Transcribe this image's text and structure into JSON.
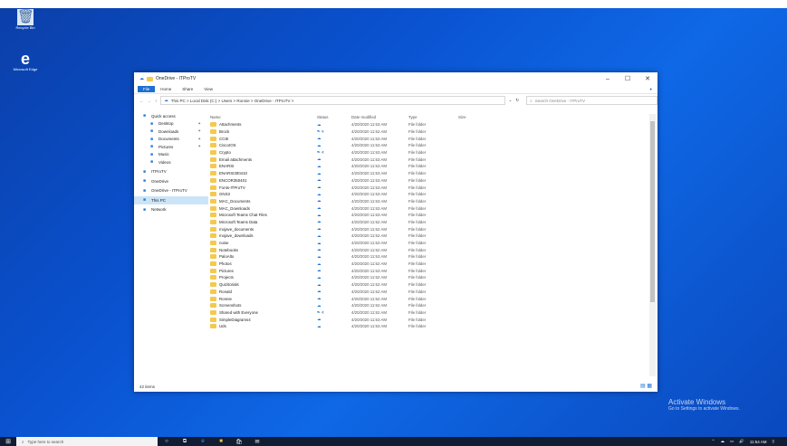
{
  "desktop": {
    "icons": [
      {
        "name": "recycle-bin-icon",
        "label": "Recycle Bin"
      },
      {
        "name": "edge-icon",
        "label": "Microsoft Edge"
      }
    ]
  },
  "window": {
    "title": "OneDrive - ITProTV",
    "ribbon_tabs": [
      "File",
      "Home",
      "Share",
      "View"
    ],
    "breadcrumb": "This PC  >  Local Disk (C:)  >  Users  >  Ronnie  >  OneDrive - ITProTV  >",
    "search_placeholder": "Search OneDrive - ITProTV",
    "nav": [
      {
        "label": "Quick access",
        "level": 0,
        "icon": "star-icon",
        "pin": false
      },
      {
        "label": "Desktop",
        "level": 1,
        "icon": "desktop-icon",
        "pin": true
      },
      {
        "label": "Downloads",
        "level": 1,
        "icon": "download-icon",
        "pin": true
      },
      {
        "label": "Documents",
        "level": 1,
        "icon": "documents-icon",
        "pin": true
      },
      {
        "label": "Pictures",
        "level": 1,
        "icon": "pictures-icon",
        "pin": true
      },
      {
        "label": "Music",
        "level": 1,
        "icon": "music-icon",
        "pin": false
      },
      {
        "label": "Videos",
        "level": 1,
        "icon": "videos-icon",
        "pin": false
      },
      {
        "label": "ITProTV",
        "level": 0,
        "icon": "user-icon",
        "pin": false
      },
      {
        "label": "OneDrive",
        "level": 0,
        "icon": "cloud-icon",
        "pin": false
      },
      {
        "label": "OneDrive - ITProTV",
        "level": 0,
        "icon": "cloud-icon",
        "pin": false
      },
      {
        "label": "This PC",
        "level": 0,
        "icon": "computer-icon",
        "pin": false,
        "selected": true
      },
      {
        "label": "Network",
        "level": 0,
        "icon": "network-icon",
        "pin": false
      }
    ],
    "columns": {
      "name": "Name",
      "status": "Status",
      "date": "Date modified",
      "type": "Type",
      "size": "Size"
    },
    "files": [
      {
        "name": "Attachments",
        "status": "☁",
        "date": "4/20/2020 11:53 AM",
        "type": "File folder"
      },
      {
        "name": "Brock",
        "status": "☁ ዳ",
        "date": "4/20/2020 11:52 AM",
        "type": "File folder"
      },
      {
        "name": "CCIE",
        "status": "☁",
        "date": "4/20/2020 11:53 AM",
        "type": "File folder"
      },
      {
        "name": "CiscoIOS",
        "status": "☁",
        "date": "4/20/2020 11:53 AM",
        "type": "File folder"
      },
      {
        "name": "Crypto",
        "status": "☁ ዳ",
        "date": "4/20/2020 11:53 AM",
        "type": "File folder"
      },
      {
        "name": "Email attachments",
        "status": "☁",
        "date": "4/20/2020 11:53 AM",
        "type": "File folder"
      },
      {
        "name": "ENARSI",
        "status": "☁",
        "date": "4/20/2020 11:53 AM",
        "type": "File folder"
      },
      {
        "name": "ENARSI300410",
        "status": "☁",
        "date": "4/20/2020 11:53 AM",
        "type": "File folder"
      },
      {
        "name": "ENCOR350401",
        "status": "☁",
        "date": "4/20/2020 11:53 AM",
        "type": "File folder"
      },
      {
        "name": "Fonts-ITProTV",
        "status": "☁",
        "date": "4/20/2020 11:53 AM",
        "type": "File folder"
      },
      {
        "name": "GNS3",
        "status": "☁",
        "date": "4/20/2020 11:53 AM",
        "type": "File folder"
      },
      {
        "name": "MAC_Documents",
        "status": "☁",
        "date": "4/20/2020 11:53 AM",
        "type": "File folder"
      },
      {
        "name": "MAC_Downloads",
        "status": "☁",
        "date": "4/20/2020 11:53 AM",
        "type": "File folder"
      },
      {
        "name": "Microsoft Teams Chat Files",
        "status": "☁",
        "date": "4/20/2020 11:53 AM",
        "type": "File folder"
      },
      {
        "name": "Microsoft Teams Data",
        "status": "☁",
        "date": "4/20/2020 11:52 AM",
        "type": "File folder"
      },
      {
        "name": "mojave_documents",
        "status": "☁",
        "date": "4/20/2020 11:52 AM",
        "type": "File folder"
      },
      {
        "name": "mojave_downloads",
        "status": "☁",
        "date": "4/20/2020 11:52 AM",
        "type": "File folder"
      },
      {
        "name": "noise",
        "status": "☁",
        "date": "4/20/2020 11:53 AM",
        "type": "File folder"
      },
      {
        "name": "Notebooks",
        "status": "☁",
        "date": "4/20/2020 11:52 AM",
        "type": "File folder"
      },
      {
        "name": "PaloAlto",
        "status": "☁",
        "date": "4/20/2020 11:53 AM",
        "type": "File folder"
      },
      {
        "name": "Photos",
        "status": "☁",
        "date": "4/20/2020 11:52 AM",
        "type": "File folder"
      },
      {
        "name": "Pictures",
        "status": "☁",
        "date": "4/20/2020 11:53 AM",
        "type": "File folder"
      },
      {
        "name": "Projects",
        "status": "☁",
        "date": "4/20/2020 11:52 AM",
        "type": "File folder"
      },
      {
        "name": "Quizitorials",
        "status": "☁",
        "date": "4/20/2020 11:52 AM",
        "type": "File folder"
      },
      {
        "name": "Ronald",
        "status": "☁",
        "date": "4/20/2020 11:52 AM",
        "type": "File folder"
      },
      {
        "name": "Ronnie",
        "status": "☁",
        "date": "4/20/2020 11:52 AM",
        "type": "File folder"
      },
      {
        "name": "Screenshots",
        "status": "☁",
        "date": "4/20/2020 11:52 AM",
        "type": "File folder"
      },
      {
        "name": "Shared with Everyone",
        "status": "☁ ዳ",
        "date": "4/20/2020 11:52 AM",
        "type": "File folder"
      },
      {
        "name": "SimpleDiagrams4",
        "status": "☁",
        "date": "4/20/2020 11:53 AM",
        "type": "File folder"
      },
      {
        "name": "Uds",
        "status": "☁",
        "date": "4/20/2020 11:53 AM",
        "type": "File folder"
      }
    ],
    "status_count": "42 items"
  },
  "watermark": {
    "title": "Activate Windows",
    "subtitle": "Go to Settings to activate Windows."
  },
  "taskbar": {
    "search_placeholder": "Type here to search",
    "time": "11:54 AM",
    "pinned_icons": [
      "cortana-icon",
      "task-view-icon",
      "edge-icon",
      "file-explorer-icon",
      "store-icon",
      "mail-icon"
    ]
  },
  "colors": {
    "accent": "#1e6fd1",
    "folder": "#f4c94f",
    "taskbar": "#101d33"
  }
}
